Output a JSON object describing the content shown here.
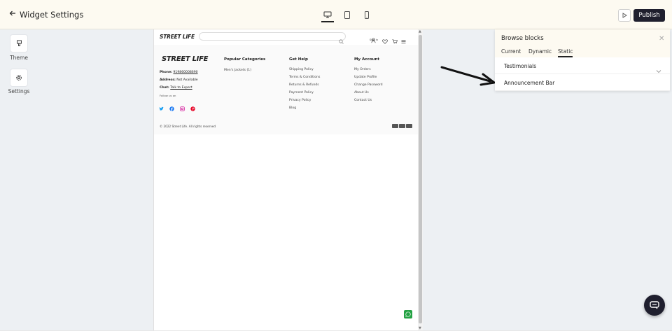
{
  "header": {
    "back_icon": "arrow-left-icon",
    "title": "Widget Settings",
    "devices": [
      {
        "name": "desktop-icon",
        "active": true
      },
      {
        "name": "tablet-icon",
        "active": false
      },
      {
        "name": "mobile-icon",
        "active": false
      }
    ],
    "preview_icon": "play-icon",
    "publish_label": "Publish"
  },
  "sidebar": {
    "items": [
      {
        "icon": "brush-icon",
        "label": "Theme"
      },
      {
        "icon": "gear-icon",
        "label": "Settings"
      }
    ]
  },
  "preview": {
    "site_header": {
      "logo": "STREET LIFE",
      "search_placeholder": "",
      "signin_label": "Sign in"
    },
    "footer": {
      "logo": "STREET LIFE",
      "contact": {
        "phone_label": "Phone:",
        "phone_value": "919860008690",
        "address_label": "Address:",
        "address_value": "Not Available",
        "chat_label": "Chat:",
        "chat_value": "Talk to Expert",
        "follow_label": "Follow us on"
      },
      "columns": [
        {
          "heading": "Popular Categories",
          "links": [
            "Men's Jackets (1)"
          ]
        },
        {
          "heading": "Get Help",
          "links": [
            "Shipping Policy",
            "Terms & Conditions",
            "Returns & Refunds",
            "Payment Policy",
            "Privacy Policy",
            "Blog"
          ]
        },
        {
          "heading": "My Account",
          "links": [
            "My Orders",
            "Update Profile",
            "Change Password",
            "About Us",
            "Contact Us"
          ]
        }
      ],
      "social": [
        "twitter-icon",
        "facebook-icon",
        "instagram-icon",
        "pinterest-icon"
      ],
      "copyright": "© 2022 Street Life. All rights reserved",
      "payment_icons": [
        "card-icon",
        "visa-icon",
        "amex-icon"
      ]
    }
  },
  "panel": {
    "title": "Browse blocks",
    "tabs": [
      {
        "label": "Current",
        "active": false
      },
      {
        "label": "Dynamic",
        "active": false
      },
      {
        "label": "Static",
        "active": true
      }
    ],
    "blocks": [
      {
        "label": "Testimonials",
        "expandable": true
      },
      {
        "label": "Announcement Bar",
        "expandable": false
      }
    ]
  },
  "colors": {
    "topbar_bg": "#fdfaf1",
    "publish_bg": "#1f1f2e",
    "canvas_bg": "#edf0f3",
    "whatsapp": "#25a244"
  }
}
